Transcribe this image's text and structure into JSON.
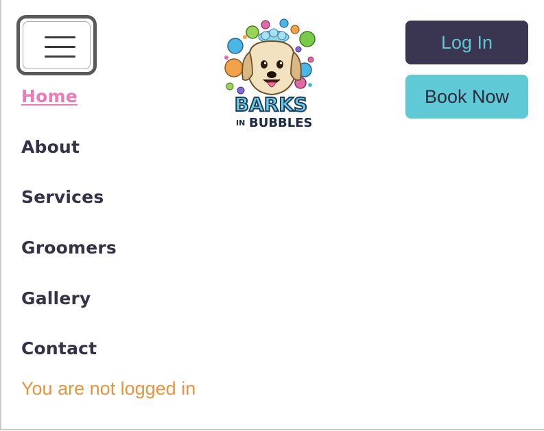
{
  "header": {
    "menu_icon": "hamburger-menu-icon",
    "logo": {
      "text_line1": "BARKS",
      "text_line2_small": "IN",
      "text_line2": "BUBBLES"
    },
    "login_label": "Log In",
    "book_label": "Book Now"
  },
  "nav": {
    "items": [
      {
        "label": "Home"
      },
      {
        "label": "About"
      },
      {
        "label": "Services"
      },
      {
        "label": "Groomers"
      },
      {
        "label": "Gallery"
      },
      {
        "label": "Contact"
      }
    ]
  },
  "status": {
    "text": "You are not logged in"
  },
  "colors": {
    "active_link": "#ee7ab8",
    "nav_text": "#363147",
    "login_bg": "#3a3550",
    "login_text": "#5ec8d4",
    "book_bg": "#5fcad5",
    "book_text": "#2f2b3f",
    "status_text": "#e4953f"
  }
}
